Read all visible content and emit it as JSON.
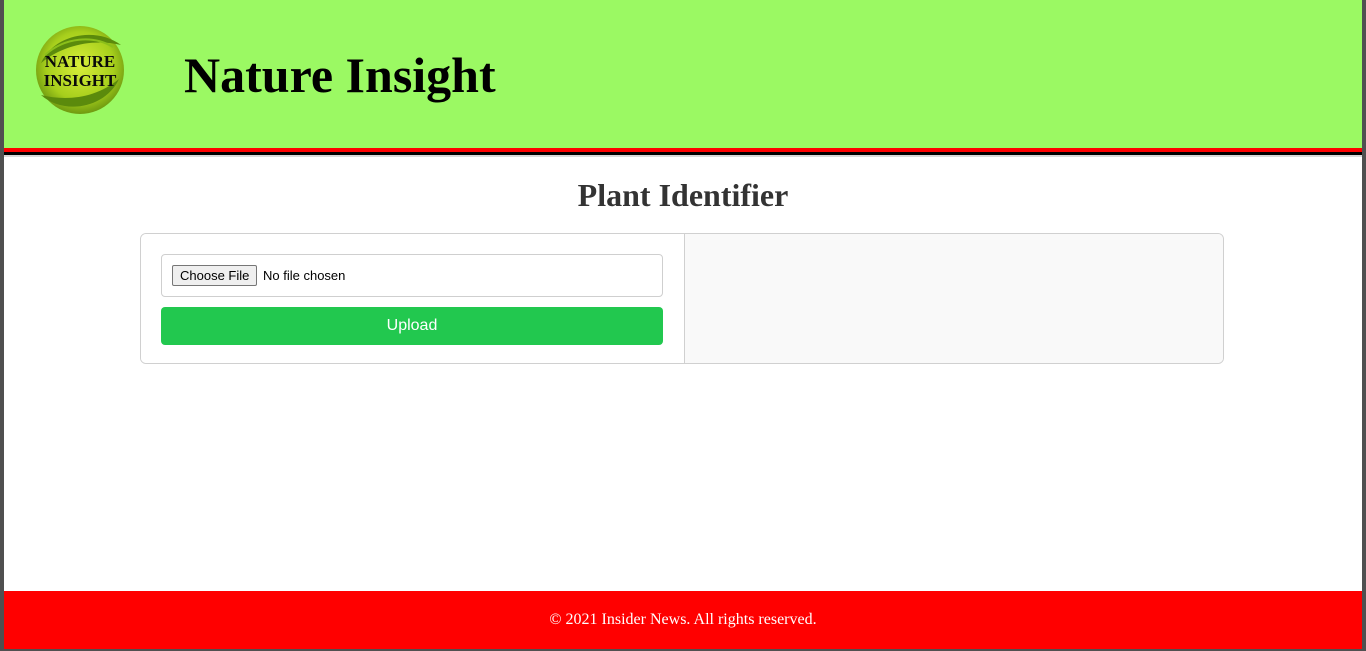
{
  "header": {
    "logo_line1": "NATURE",
    "logo_line2": "INSIGHT",
    "site_title": "Nature Insight",
    "background_color": "#9bf963"
  },
  "main": {
    "page_heading": "Plant Identifier",
    "upload_form": {
      "choose_file_label": "Choose File",
      "file_status": "No file chosen",
      "upload_label": "Upload",
      "upload_color": "#22c84f"
    },
    "result_panel": {
      "background_color": "#f9f9f9"
    }
  },
  "footer": {
    "copyright": "© 2021 Insider News. All rights reserved.",
    "background_color": "#ff0000"
  }
}
